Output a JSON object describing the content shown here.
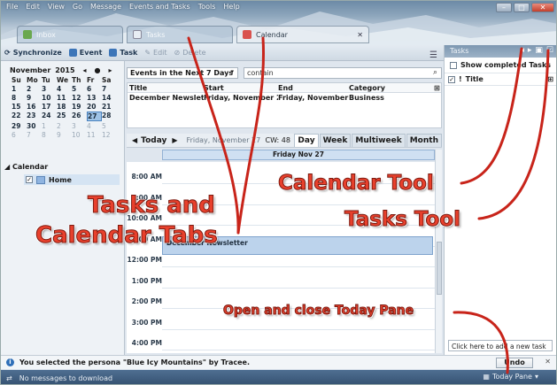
{
  "menubar": [
    "File",
    "Edit",
    "View",
    "Go",
    "Message",
    "Events and Tasks",
    "Tools",
    "Help"
  ],
  "tabs": [
    {
      "label": "Inbox"
    },
    {
      "label": "Tasks"
    },
    {
      "label": "Calendar"
    }
  ],
  "toolbar": {
    "synchronize": "Synchronize",
    "event": "Event",
    "task": "Task",
    "edit": "Edit",
    "delete": "Delete"
  },
  "minicalendar": {
    "month": "November",
    "year": "2015",
    "weekdays": [
      "Su",
      "Mo",
      "Tu",
      "We",
      "Th",
      "Fr",
      "Sa"
    ],
    "weeks": [
      [
        "1",
        "2",
        "3",
        "4",
        "5",
        "6",
        "7"
      ],
      [
        "8",
        "9",
        "10",
        "11",
        "12",
        "13",
        "14"
      ],
      [
        "15",
        "16",
        "17",
        "18",
        "19",
        "20",
        "21"
      ],
      [
        "22",
        "23",
        "24",
        "25",
        "26",
        "27",
        "28"
      ],
      [
        "29",
        "30",
        "1",
        "2",
        "3",
        "4",
        "5"
      ],
      [
        "6",
        "7",
        "8",
        "9",
        "10",
        "11",
        "12"
      ]
    ],
    "today": "27"
  },
  "calendars": {
    "section": "Calendar",
    "items": [
      {
        "name": "Home",
        "checked": true,
        "color": "#8fb4e0"
      }
    ]
  },
  "filter": {
    "selected": "Events in the Next 7 Days",
    "search": "contain"
  },
  "eventlist": {
    "columns": [
      "Title",
      "Start",
      "End",
      "Category"
    ],
    "rows": [
      [
        "December Newsletter",
        "Friday, November 27...",
        "Friday, November 2...",
        "Business"
      ]
    ]
  },
  "viewbar": {
    "today": "Today",
    "date": "Friday, November 27, 2...",
    "cw": "CW: 48",
    "views": [
      "Day",
      "Week",
      "Multiweek",
      "Month"
    ],
    "active": "Day"
  },
  "day": {
    "header": "Friday Nov 27",
    "hours": [
      "8:00 AM",
      "9:00 AM",
      "10:00 AM",
      "11:00 AM",
      "12:00 PM",
      "1:00 PM",
      "2:00 PM",
      "3:00 PM",
      "4:00 PM"
    ],
    "event": "December Newsletter"
  },
  "taskpane": {
    "title": "Tasks",
    "show_completed": "Show completed Tasks",
    "column": "Title",
    "add_placeholder": "Click here to add a new task"
  },
  "notification": {
    "text": "You selected the persona \"Blue Icy Mountains\" by Tracee.",
    "undo": "Undo"
  },
  "status": {
    "text": "No messages to download",
    "today_pane": "Today Pane"
  },
  "annotations": {
    "tasks_and": "Tasks and",
    "calendar_tabs": "Calendar Tabs",
    "calendar_tool": "Calendar Tool",
    "tasks_tool": "Tasks Tool",
    "today_pane": "Open and close Today Pane"
  },
  "colors": {
    "annotation": "#e8402c",
    "accent": "#3c75b8",
    "today_highlight": "#9fc3e6"
  }
}
